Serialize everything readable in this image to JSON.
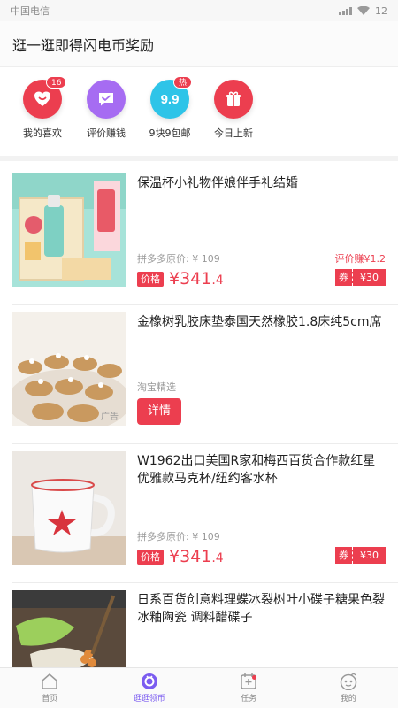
{
  "status_bar": {
    "carrier": "中国电信",
    "time": "12"
  },
  "header": {
    "title": "逛一逛即得闪电币奖励"
  },
  "quick_nav": [
    {
      "label": "我的喜欢",
      "badge": "16",
      "color": "#ec3e4f",
      "icon": "heart-icon"
    },
    {
      "label": "评价赚钱",
      "badge": "",
      "color": "#a66cf2",
      "icon": "chat-check-icon"
    },
    {
      "label": "9块9包邮",
      "badge": "热",
      "color": "#2ec4e8",
      "icon": "nine-nine-icon"
    },
    {
      "label": "今日上新",
      "badge": "",
      "color": "#ec3e4f",
      "icon": "gift-icon"
    }
  ],
  "items": [
    {
      "title": "保温杯小礼物伴娘伴手礼结婚",
      "orig_price": "拼多多原价: ¥ 109",
      "reward": "评价赚¥1.2",
      "price_tag": "价格",
      "price_int": "¥341",
      "price_dec": ".4",
      "coupon_l": "券",
      "coupon_r": "¥30"
    },
    {
      "title": "金橡树乳胶床垫泰国天然橡胶1.8床纯5cm席",
      "source": "淘宝精选",
      "button": "详情",
      "ad": "广告"
    },
    {
      "title": "W1962出口美国R家和梅西百货合作款红星优雅款马克杯/纽约客水杯",
      "orig_price": "拼多多原价: ¥ 109",
      "price_tag": "价格",
      "price_int": "¥341",
      "price_dec": ".4",
      "coupon_l": "券",
      "coupon_r": "¥30"
    },
    {
      "title": "日系百货创意料理蝶冰裂树叶小碟子糖果色裂冰釉陶瓷 调料醋碟子"
    }
  ],
  "tabbar": [
    {
      "label": "首页",
      "icon": "home-icon",
      "active": false
    },
    {
      "label": "逛逛领币",
      "icon": "browse-icon",
      "active": true
    },
    {
      "label": "任务",
      "icon": "task-icon",
      "active": false
    },
    {
      "label": "我的",
      "icon": "profile-icon",
      "active": false
    }
  ],
  "colors": {
    "accent": "#ec3e4f",
    "active_tab": "#7b5cf0"
  }
}
